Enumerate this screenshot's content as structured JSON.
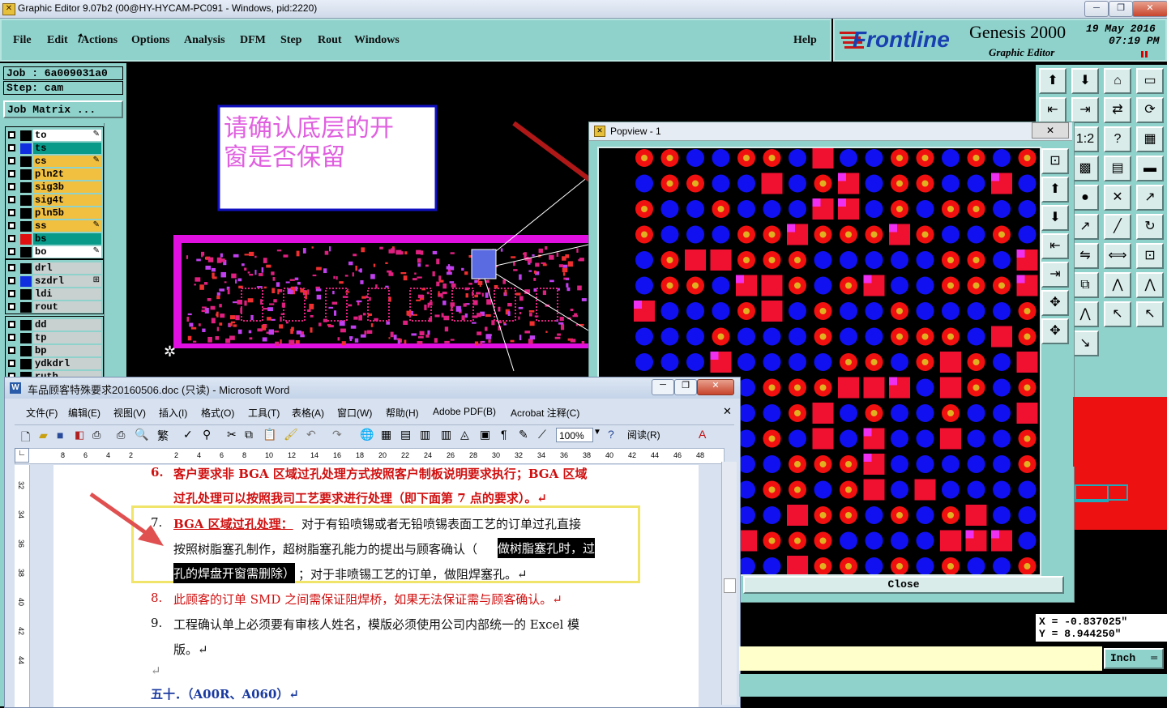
{
  "window": {
    "title": "Graphic Editor 9.07b2 (00@HY-HYCAM-PC091 - Windows, pid:2220)",
    "app_icon": "✕"
  },
  "menu": {
    "file": "File",
    "edit": "Edit",
    "actions": "Actions",
    "options": "Options",
    "analysis": "Analysis",
    "dfm": "DFM",
    "step": "Step",
    "rout": "Rout",
    "windows": "Windows",
    "help": "Help"
  },
  "brand": {
    "logo": "Frontline",
    "product": "Genesis 2000",
    "subtitle": "Graphic Editor",
    "date": "19 May 2016",
    "time": "07:19 PM"
  },
  "job": {
    "job_line": "Job : 6a009031a0",
    "step_line": "Step: cam",
    "matrix_button": "Job Matrix ..."
  },
  "layers": [
    {
      "name": "to",
      "color": "#ffffff",
      "swatch": "#000000"
    },
    {
      "name": "ts",
      "color": "#0a9a8a",
      "swatch": "#1030e0"
    },
    {
      "name": "cs",
      "color": "#f2c040",
      "swatch": "#000000"
    },
    {
      "name": "pln2t",
      "color": "#f2c040",
      "swatch": "#000000"
    },
    {
      "name": "sig3b",
      "color": "#f2c040",
      "swatch": "#000000"
    },
    {
      "name": "sig4t",
      "color": "#f2c040",
      "swatch": "#000000"
    },
    {
      "name": "pln5b",
      "color": "#f2c040",
      "swatch": "#000000"
    },
    {
      "name": "ss",
      "color": "#f2c040",
      "swatch": "#000000"
    },
    {
      "name": "bs",
      "color": "#0a9a8a",
      "swatch": "#e01010"
    },
    {
      "name": "bo",
      "color": "#ffffff",
      "swatch": "#000000"
    }
  ],
  "drill_layers": [
    {
      "name": "drl",
      "color": "#c8d0d0",
      "swatch": "#000000"
    },
    {
      "name": "szdrl",
      "color": "#c8d0d0",
      "swatch": "#1030e0"
    },
    {
      "name": "ldi",
      "color": "#c8d0d0",
      "swatch": "#000000"
    },
    {
      "name": "rout",
      "color": "#c8d0d0",
      "swatch": "#000000"
    }
  ],
  "other_layers": [
    {
      "name": "dd",
      "color": "#c8d0d0"
    },
    {
      "name": "tp",
      "color": "#c8d0d0"
    },
    {
      "name": "bp",
      "color": "#c8d0d0"
    },
    {
      "name": "ydkdrl",
      "color": "#c8d0d0"
    },
    {
      "name": "ruth",
      "color": "#c8d0d0"
    }
  ],
  "note": {
    "text_line1": "请确认底层的开",
    "text_line2": "窗是否保留"
  },
  "popview": {
    "title": "Popview - 1",
    "close_button": "Close"
  },
  "word": {
    "title": "车品顾客特殊要求20160506.doc (只读) - Microsoft Word",
    "menus": [
      "文件(F)",
      "编辑(E)",
      "视图(V)",
      "插入(I)",
      "格式(O)",
      "工具(T)",
      "表格(A)",
      "窗口(W)",
      "帮助(H)",
      "Adobe PDF(B)",
      "Acrobat 注释(C)"
    ],
    "zoom": "100%",
    "reading_button": "阅读(R)",
    "ruler_ticks": [
      "8",
      "6",
      "4",
      "2",
      "",
      "2",
      "4",
      "6",
      "8",
      "10",
      "12",
      "14",
      "16",
      "18",
      "20",
      "22",
      "24",
      "26",
      "28",
      "30",
      "32",
      "34",
      "36",
      "38",
      "40",
      "42",
      "44",
      "46",
      "48"
    ],
    "vruler_ticks": [
      "32",
      "34",
      "36",
      "38",
      "40",
      "42",
      "44"
    ],
    "items": {
      "i6_num": "6.",
      "i6_a": "客户要求非 BGA 区域过孔处理方式按照客户制板说明要求执行；BGA 区域",
      "i6_b": "过孔处理可以按照我司工艺要求进行处理（即下面第 7 点的要求）。↵",
      "i7_num": "7.",
      "i7_head": "BGA 区域过孔处理：",
      "i7_a": "对于有铅喷锡或者无铅喷锡表面工艺的订单过孔直接",
      "i7_b1": "按照树脂塞孔制作，超树脂塞孔能力的提出与顾客确认（",
      "i7_b2": "做树脂塞孔时，过",
      "i7_c1": "孔的焊盘开窗需删除）",
      "i7_c2": "；对于非喷锡工艺的订单，做阻焊塞孔。↵",
      "i8_num": "8.",
      "i8": "此顾客的订单 SMD 之间需保证阻焊桥，如果无法保证需与顾客确认。↵",
      "i9_num": "9.",
      "i9_a": "工程确认单上必须要有审核人姓名，模版必须使用公司内部统一的 Excel 模",
      "i9_b": "版。↵",
      "blank": "↵",
      "heading": "五十．（A00R、A060）↵"
    }
  },
  "status": {
    "x": "X = -0.837025\"",
    "y": "Y = 8.944250\"",
    "units": "Inch"
  },
  "icons": {
    "toolbar": [
      "home-icon",
      "open-icon",
      "house-icon",
      "window-icon",
      "prev-icon",
      "next-icon",
      "flip-icon",
      "rotate-icon",
      "move-icon",
      "ratio-icon",
      "help-icon",
      "grid-icon",
      "net-icon",
      "snap-icon",
      "ruler-icon",
      "dot-icon",
      "cross-icon",
      "connect-icon",
      "connect2-icon",
      "line-icon",
      "arc-icon",
      "split-icon",
      "measure-icon",
      "boxzoom-icon",
      "layers-icon",
      "arc-up-icon",
      "arc-a-icon",
      "arc-b-icon",
      "pointer-icon",
      "pointer2-icon",
      "pointer3-icon"
    ]
  }
}
